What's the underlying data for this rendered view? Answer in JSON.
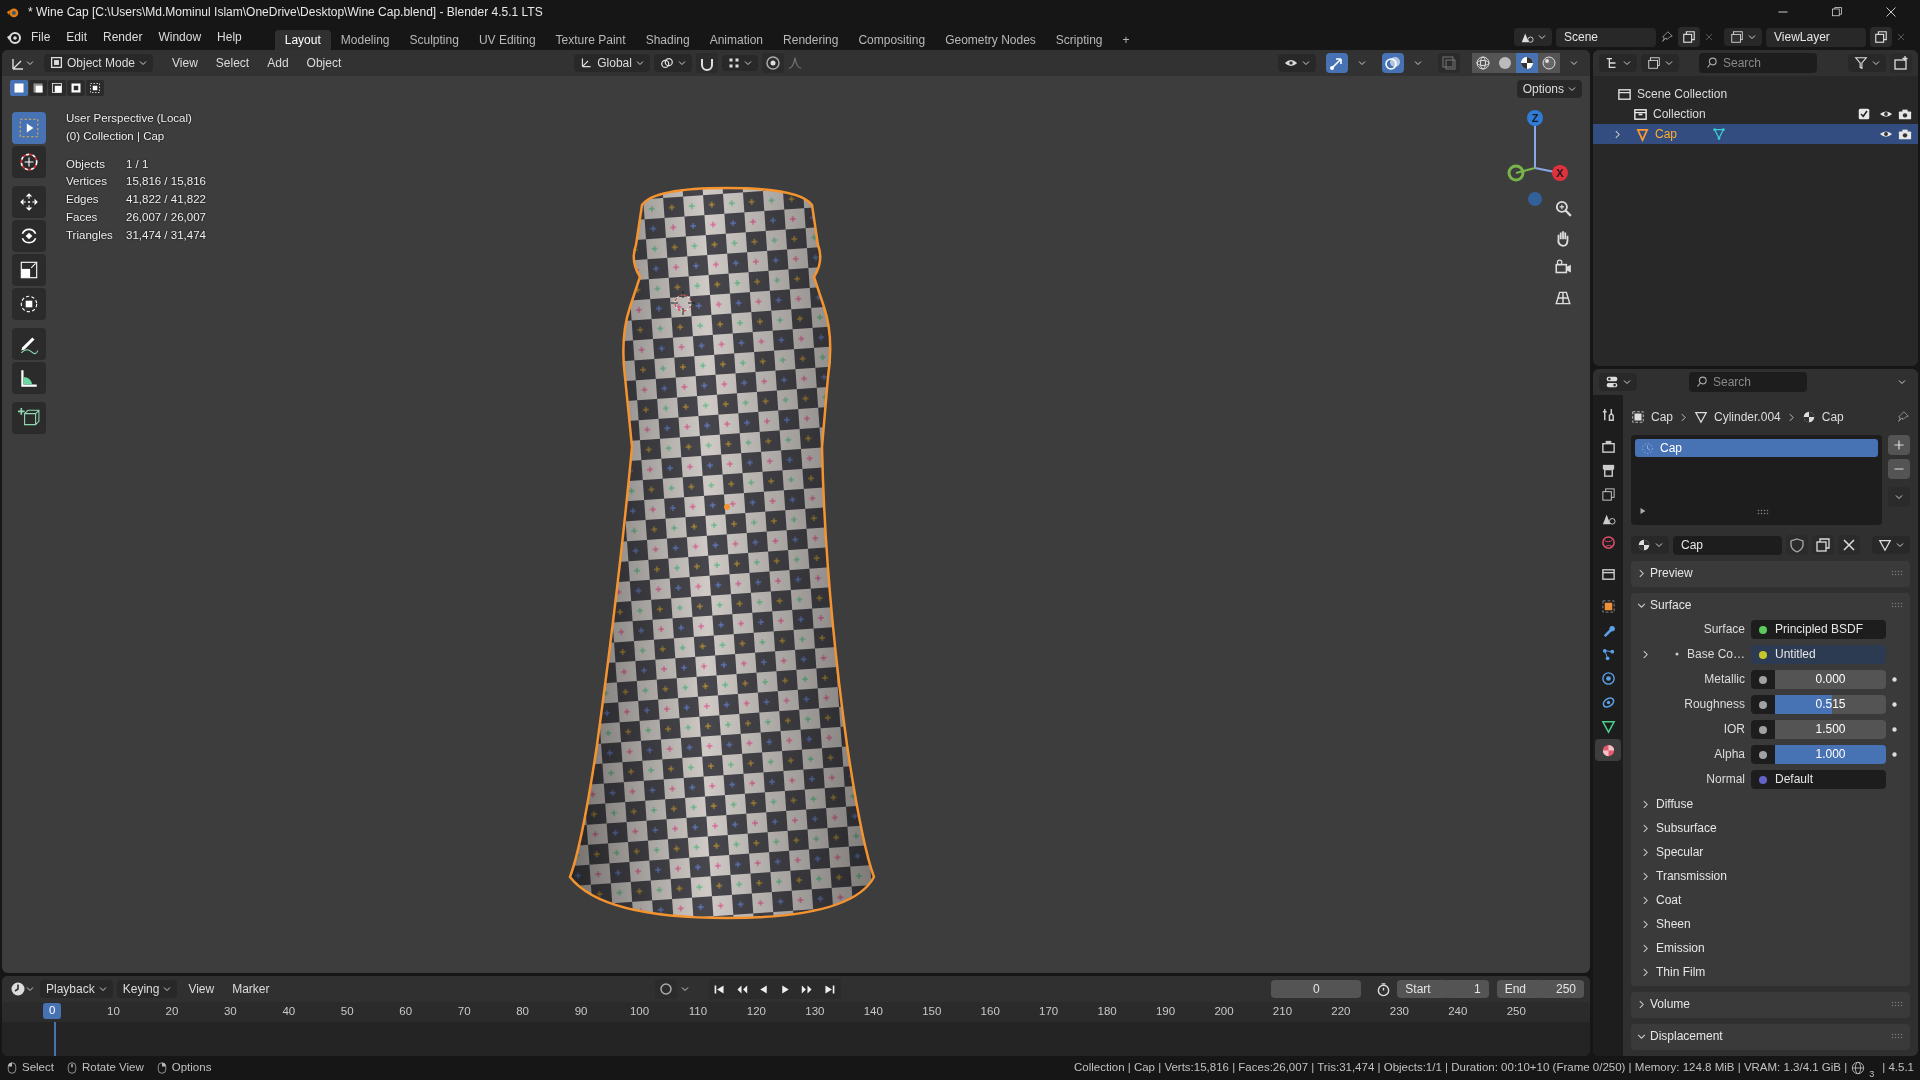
{
  "window": {
    "title": "* Wine Cap [C:\\Users\\Md.Mominul Islam\\OneDrive\\Desktop\\Wine Cap.blend] - Blender 4.5.1 LTS"
  },
  "menu": [
    "File",
    "Edit",
    "Render",
    "Window",
    "Help"
  ],
  "workspaces": [
    {
      "label": "Layout",
      "selected": true
    },
    {
      "label": "Modeling",
      "selected": false
    },
    {
      "label": "Sculpting",
      "selected": false
    },
    {
      "label": "UV Editing",
      "selected": false
    },
    {
      "label": "Texture Paint",
      "selected": false
    },
    {
      "label": "Shading",
      "selected": false
    },
    {
      "label": "Animation",
      "selected": false
    },
    {
      "label": "Rendering",
      "selected": false
    },
    {
      "label": "Compositing",
      "selected": false
    },
    {
      "label": "Geometry Nodes",
      "selected": false
    },
    {
      "label": "Scripting",
      "selected": false
    }
  ],
  "add_workspace": "+",
  "scene": {
    "name": "Scene"
  },
  "view_layer": {
    "name": "ViewLayer"
  },
  "viewport": {
    "mode": "Object Mode",
    "menus": [
      "View",
      "Select",
      "Add",
      "Object"
    ],
    "orientation": "Global",
    "options": "Options",
    "toggles": [
      {
        "kind": "gizmo",
        "on": true
      },
      {
        "kind": "overlay",
        "on": true
      },
      {
        "kind": "xray",
        "on": false
      }
    ],
    "shading": [
      {
        "kind": "wireframe",
        "selected": false
      },
      {
        "kind": "solid",
        "selected": false
      },
      {
        "kind": "material",
        "selected": true
      },
      {
        "kind": "rendered",
        "selected": false
      }
    ],
    "select_modes": [
      {
        "selected": true
      },
      {
        "selected": false
      },
      {
        "selected": false
      },
      {
        "selected": false
      },
      {
        "selected": false
      }
    ],
    "tools": [
      {
        "kind": "select",
        "selected": true
      },
      {
        "kind": "cursor",
        "selected": false
      },
      {
        "kind": "move",
        "selected": false
      },
      {
        "kind": "rotate",
        "selected": false
      },
      {
        "kind": "scale",
        "selected": false
      },
      {
        "kind": "transform",
        "selected": false
      },
      {
        "kind": "annotate",
        "selected": false
      },
      {
        "kind": "measure",
        "selected": false
      },
      {
        "kind": "add-cube",
        "selected": false
      }
    ],
    "info": [
      "User Perspective (Local)",
      "(0) Collection | Cap"
    ],
    "stats": [
      {
        "label": "Objects",
        "value": "1 / 1"
      },
      {
        "label": "Vertices",
        "value": "15,816 / 15,816"
      },
      {
        "label": "Edges",
        "value": "41,822 / 41,822"
      },
      {
        "label": "Faces",
        "value": "26,007 / 26,007"
      },
      {
        "label": "Triangles",
        "value": "31,474 / 31,474"
      }
    ],
    "gizmo": {
      "z": "Z",
      "x": "X"
    }
  },
  "outliner": {
    "search": {
      "placeholder": "Search"
    },
    "items": [
      {
        "label": "Scene Collection",
        "kind": "scene",
        "selected": false
      },
      {
        "label": "Collection",
        "kind": "collection",
        "selected": false,
        "checked": true
      },
      {
        "label": "Cap",
        "kind": "object",
        "selected": true
      }
    ]
  },
  "properties": {
    "search": {
      "placeholder": "Search"
    },
    "tabs": [
      {
        "kind": "tool",
        "selected": false
      },
      {
        "kind": "render",
        "selected": false
      },
      {
        "kind": "output",
        "selected": false
      },
      {
        "kind": "view-layer",
        "selected": false
      },
      {
        "kind": "scene",
        "selected": false
      },
      {
        "kind": "world",
        "selected": false
      },
      {
        "kind": "collection",
        "selected": false
      },
      {
        "kind": "object",
        "selected": false
      },
      {
        "kind": "modifier",
        "selected": false
      },
      {
        "kind": "particles",
        "selected": false
      },
      {
        "kind": "physics",
        "selected": false
      },
      {
        "kind": "constraints",
        "selected": false
      },
      {
        "kind": "data",
        "selected": false
      },
      {
        "kind": "material",
        "selected": true
      }
    ],
    "breadcrumb": [
      "Cap",
      "Cylinder.004",
      "Cap"
    ],
    "slots": [
      {
        "label": "Cap",
        "selected": true
      }
    ],
    "material": "Cap",
    "panels": [
      {
        "title": "Preview",
        "expanded": false
      },
      {
        "title": "Surface",
        "expanded": true,
        "fields": [
          {
            "label": "Surface",
            "kind": "link",
            "value": "Principled BSDF",
            "color": "#5cc95c"
          },
          {
            "label": "Base Co…",
            "kind": "link",
            "value": "Untitled",
            "color": "#c7c729",
            "expandable": true
          },
          {
            "label": "Metallic",
            "kind": "slider",
            "value": "0.000",
            "level": 0,
            "color": "#a1a1a1"
          },
          {
            "label": "Roughness",
            "kind": "slider",
            "value": "0.515",
            "level": 0.515,
            "color": "#a1a1a1"
          },
          {
            "label": "IOR",
            "kind": "number",
            "value": "1.500",
            "color": "#a1a1a1"
          },
          {
            "label": "Alpha",
            "kind": "slider",
            "value": "1.000",
            "level": 1,
            "color": "#a1a1a1"
          },
          {
            "label": "Normal",
            "kind": "link",
            "value": "Default",
            "color": "#6363c7"
          }
        ],
        "subpanels": [
          {
            "title": "Diffuse",
            "expanded": false
          },
          {
            "title": "Subsurface",
            "expanded": false
          },
          {
            "title": "Specular",
            "expanded": false
          },
          {
            "title": "Transmission",
            "expanded": false
          },
          {
            "title": "Coat",
            "expanded": false
          },
          {
            "title": "Sheen",
            "expanded": false
          },
          {
            "title": "Emission",
            "expanded": false
          },
          {
            "title": "Thin Film",
            "expanded": false
          }
        ]
      },
      {
        "title": "Volume",
        "expanded": false
      },
      {
        "title": "Displacement",
        "expanded": true
      }
    ]
  },
  "timeline": {
    "menus": [
      {
        "label": "Playback",
        "kind": "dropdown"
      },
      {
        "label": "Keying",
        "kind": "dropdown"
      },
      {
        "label": "View",
        "kind": "menu"
      },
      {
        "label": "Marker",
        "kind": "menu"
      }
    ],
    "current_frame": "0",
    "start": {
      "label": "Start",
      "value": "1"
    },
    "end": {
      "label": "End",
      "value": "250"
    },
    "playhead": "0",
    "ticks": [
      "10",
      "20",
      "30",
      "40",
      "50",
      "60",
      "70",
      "80",
      "90",
      "100",
      "110",
      "120",
      "130",
      "140",
      "150",
      "160",
      "170",
      "180",
      "190",
      "200",
      "210",
      "220",
      "230",
      "240",
      "250"
    ]
  },
  "status_bar": {
    "hints": [
      "Select",
      "Rotate View",
      "Options"
    ],
    "stats": "Collection | Cap | Verts:15,816 | Faces:26,007 | Tris:31,474 | Objects:1/1 | Duration: 00:10+10 (Frame 0/250) | Memory: 124.8 MiB | VRAM: 1.3/4.1 GiB |",
    "network_count": "3",
    "version": "| 4.5.1"
  }
}
